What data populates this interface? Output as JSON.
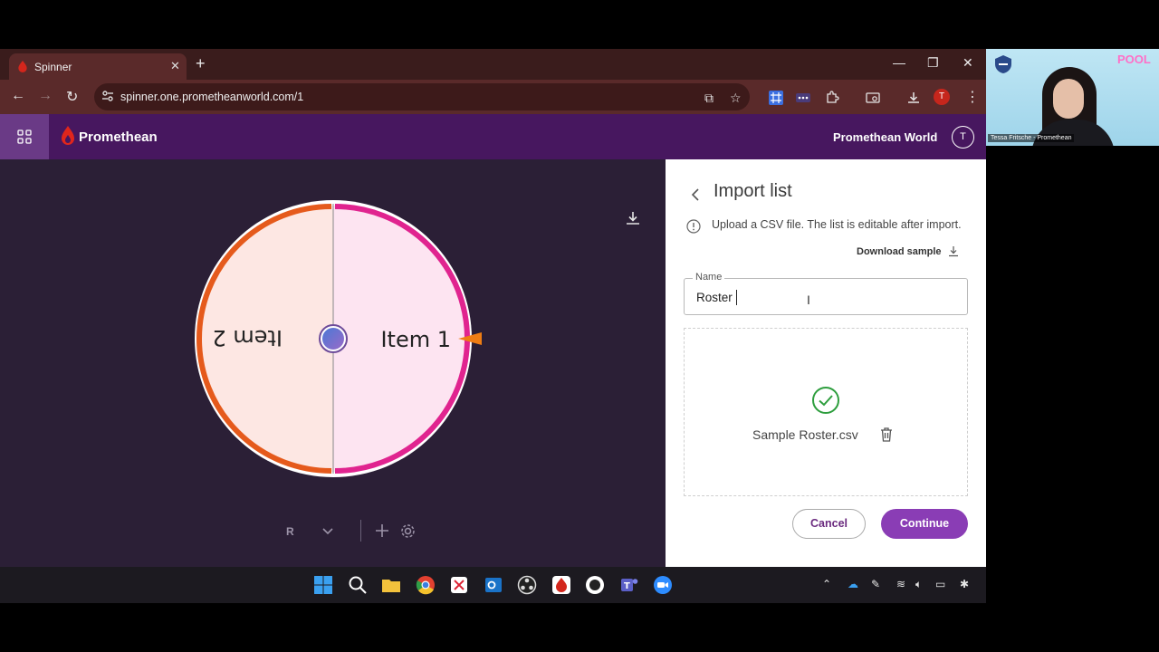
{
  "browser": {
    "tab_title": "Spinner",
    "url": "spinner.one.prometheanworld.com/1",
    "profile_initial": "T"
  },
  "app": {
    "brand": "Promethean",
    "world_label": "Promethean World",
    "user_initial": "T"
  },
  "wheel": {
    "items": [
      "Item 1",
      "Item 2"
    ],
    "colors": {
      "item1_fill": "#fde4f1",
      "item1_rim": "#e0248f",
      "item2_fill": "#fde7e3",
      "item2_rim": "#e55a1c",
      "pointer": "#ef7d13"
    }
  },
  "controls": {
    "mode_label": "R"
  },
  "import": {
    "title": "Import list",
    "info": "Upload a CSV file. The list is editable after import.",
    "download_sample": "Download sample",
    "name_label": "Name",
    "name_value": "Roster",
    "file_name": "Sample Roster.csv",
    "cancel": "Cancel",
    "continue": "Continue"
  },
  "webcam": {
    "caption": "Tessa Fritsche - Promethean",
    "overlay_text": "POOL"
  },
  "accent": "#8a3db5"
}
